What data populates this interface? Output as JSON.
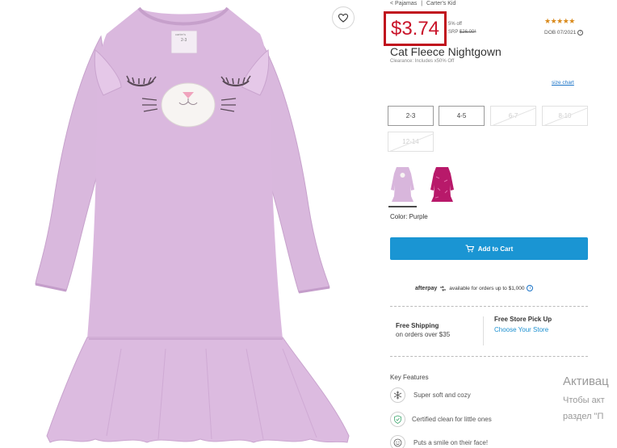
{
  "breadcrumb": {
    "parent": "< Pajamas",
    "separator": "|",
    "brand": "Carter's Kid"
  },
  "price": {
    "sale": "$3.74",
    "percent_off": "5% off",
    "srp_label": "SRP",
    "srp_value": "$26.00*"
  },
  "rating": {
    "stars": "★★★★★",
    "dob": "DOB 07/2021"
  },
  "product": {
    "title": "Cat Fleece Nightgown",
    "clearance_note": "Clearance: Includes x50% Off",
    "garment_tag_brand": "carter's",
    "garment_tag_size": "2-3"
  },
  "wishlist_icon": "heart-icon",
  "size_chart_label": "size chart",
  "sizes": [
    {
      "label": "2-3",
      "available": true
    },
    {
      "label": "4-5",
      "available": true
    },
    {
      "label": "6-7",
      "available": false
    },
    {
      "label": "8-10",
      "available": false
    },
    {
      "label": "12-14",
      "available": false
    }
  ],
  "swatches": [
    {
      "color": "Purple",
      "hex": "#d8b6dc",
      "selected": true
    },
    {
      "color": "Magenta",
      "hex": "#b8196a",
      "selected": false
    }
  ],
  "color_label": "Color: Purple",
  "add_to_cart_label": "Add to Cart",
  "afterpay": {
    "brand": "afterpay",
    "text": "available for orders up to $1,000"
  },
  "shipping": {
    "title": "Free Shipping",
    "subtitle": "on orders over $35"
  },
  "pickup": {
    "title": "Free Store Pick Up",
    "link": "Choose Your Store"
  },
  "key_features": {
    "title": "Key Features",
    "items": [
      {
        "icon": "snowflake-icon",
        "text": "Super soft and cozy"
      },
      {
        "icon": "shield-check-icon",
        "text": "Certified clean for little ones"
      },
      {
        "icon": "smile-icon",
        "text": "Puts a smile on their face!"
      }
    ]
  },
  "windows_activation": {
    "title": "Активац",
    "line1": "Чтобы акт",
    "line2": "раздел \"П"
  },
  "colors": {
    "price_red": "#c9142a",
    "primary_blue": "#1a95d3",
    "link_blue": "#1a73c7",
    "star_gold": "#d9891a",
    "gown_lilac": "#d8b6dc"
  }
}
